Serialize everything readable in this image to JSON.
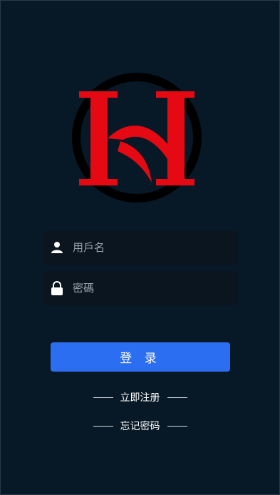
{
  "logo": {
    "name": "h-logo",
    "color": "#e50914",
    "ring_color": "#000000"
  },
  "form": {
    "username_placeholder": "用戶名",
    "password_placeholder": "密碼"
  },
  "actions": {
    "login_label": "登 录",
    "register_label": "立即注册",
    "forgot_label": "忘记密码"
  },
  "colors": {
    "background": "#071826",
    "field_bg": "#0b1520",
    "primary": "#2c6ef2"
  }
}
